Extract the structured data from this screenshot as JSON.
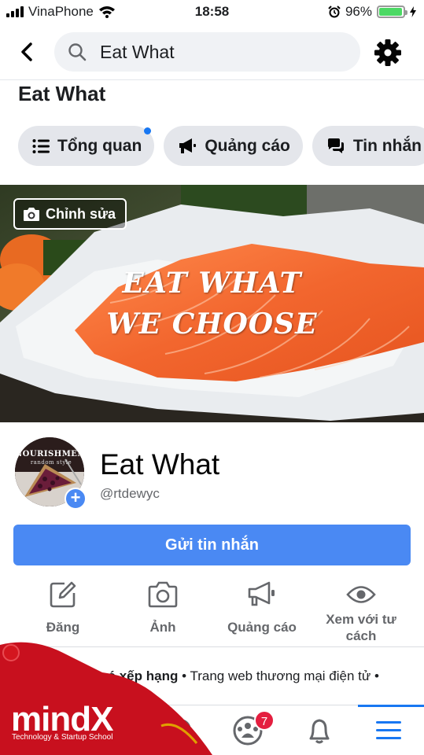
{
  "status_bar": {
    "carrier": "VinaPhone",
    "time": "18:58",
    "battery_percent": "96%",
    "battery_level": 0.96
  },
  "header": {
    "search_value": "Eat What",
    "back_icon": "chevron-left-icon",
    "settings_icon": "gear-icon"
  },
  "page": {
    "heading": "Eat What",
    "name": "Eat What",
    "username": "@rtdewyc"
  },
  "tabs": [
    {
      "label": "Tổng quan",
      "icon": "list-icon",
      "has_dot": true
    },
    {
      "label": "Quảng cáo",
      "icon": "megaphone-icon",
      "has_dot": false
    },
    {
      "label": "Tin nhắn",
      "icon": "chat-icon",
      "has_dot": false
    }
  ],
  "cover": {
    "edit_label": "Chỉnh sửa",
    "text_line1": "EAT WHAT",
    "text_line2": "WE CHOOSE"
  },
  "avatar": {
    "text": "NOURISHMENT",
    "subtext": "random style"
  },
  "send_button": "Gửi tin nhắn",
  "actions": [
    {
      "label": "Đăng",
      "icon": "edit-icon"
    },
    {
      "label": "Ảnh",
      "icon": "camera-icon"
    },
    {
      "label": "Quảng cáo",
      "icon": "megaphone-icon"
    },
    {
      "label": "Xem với tư cách",
      "icon": "eye-icon"
    }
  ],
  "info": {
    "rating": "Chưa có xếp hạng",
    "category": "• Trang web thương mại điện tử •"
  },
  "bottom_nav": {
    "groups_badge": "7",
    "items": [
      "home-icon",
      "search-icon",
      "groups-icon",
      "bell-icon",
      "menu-icon"
    ]
  },
  "watermark": {
    "brand": "mindX",
    "tagline": "Technology & Startup School"
  },
  "colors": {
    "accent": "#4a89f3",
    "facebook_blue": "#1877f2",
    "badge_red": "#e41e3f",
    "watermark_red": "#c8101e"
  }
}
